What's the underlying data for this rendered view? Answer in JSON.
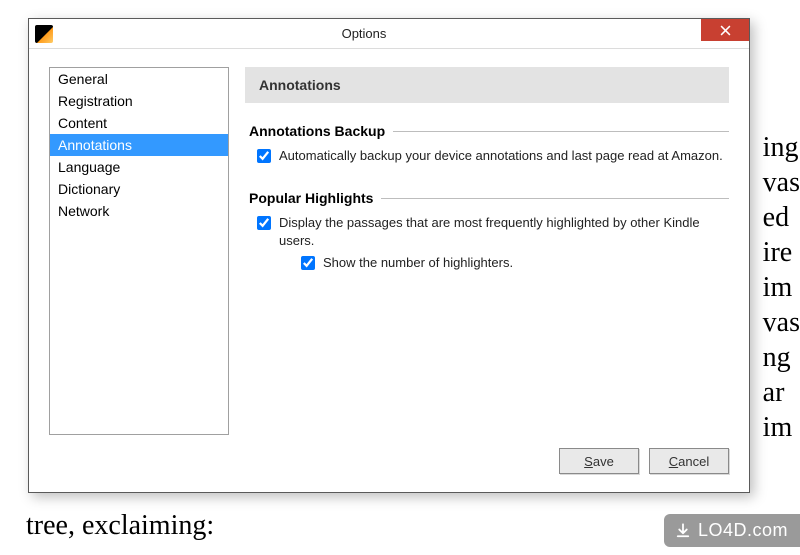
{
  "window": {
    "title": "Options"
  },
  "sidebar": {
    "items": [
      {
        "label": "General"
      },
      {
        "label": "Registration"
      },
      {
        "label": "Content"
      },
      {
        "label": "Annotations",
        "selected": true
      },
      {
        "label": "Language"
      },
      {
        "label": "Dictionary"
      },
      {
        "label": "Network"
      }
    ]
  },
  "panel": {
    "title": "Annotations",
    "sections": {
      "backup": {
        "title": "Annotations Backup",
        "auto_backup": {
          "checked": true,
          "label": "Automatically backup your device annotations and last page read at Amazon."
        }
      },
      "popular": {
        "title": "Popular Highlights",
        "display_passages": {
          "checked": true,
          "label": "Display the passages that are most frequently highlighted by other Kindle users."
        },
        "show_number": {
          "checked": true,
          "label": "Show the number of highlighters."
        }
      }
    }
  },
  "buttons": {
    "save": "Save",
    "cancel": "Cancel"
  },
  "background_fragments": [
    "ing",
    "vas",
    "ed",
    "ire",
    "im",
    "vas",
    "ng",
    "ar",
    "im"
  ],
  "background_bottom": "tree, exclaiming:",
  "watermark": {
    "text": "LO4D.com"
  }
}
